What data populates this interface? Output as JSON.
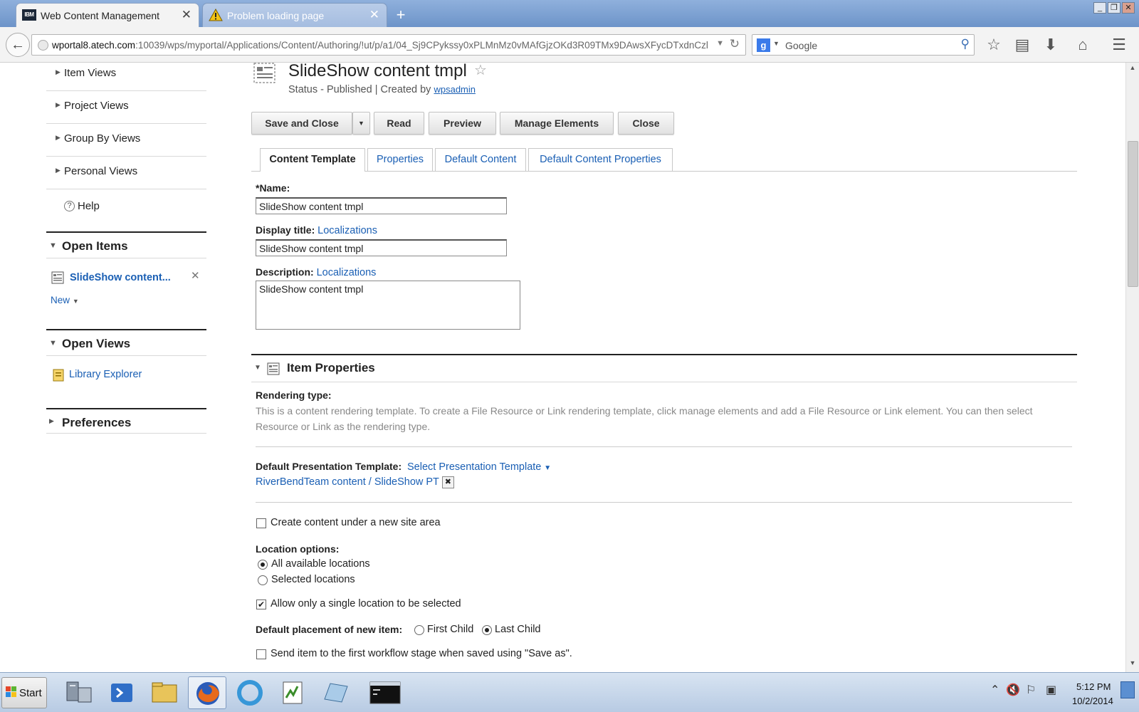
{
  "browser": {
    "tabs": [
      {
        "favicon": "IBM",
        "label": "Web Content Management",
        "close": "✕"
      },
      {
        "label": "Problem loading page",
        "close": "✕"
      }
    ],
    "new_tab": "+",
    "url_host": "wportal8.atech.com",
    "url_rest": ":10039/wps/myportal/Applications/Content/Authoring/!ut/p/a1/04_Sj9CPykssy0xPLMnMz0vMAfGjzOKd3R09TMx9DAwsXFycDTxdnCzl",
    "search_engine": "g",
    "search_placeholder": "Google"
  },
  "sidebar": {
    "views": [
      {
        "label": "Item Views"
      },
      {
        "label": "Project Views"
      },
      {
        "label": "Group By Views"
      },
      {
        "label": "Personal Views"
      }
    ],
    "help_icon": "?",
    "help_label": "Help",
    "open_items_title": "Open Items",
    "open_item_label": "SlideShow content...",
    "new_label": "New",
    "open_views_title": "Open Views",
    "library_explorer": "Library Explorer",
    "preferences_title": "Preferences"
  },
  "header": {
    "title": "SlideShow content tmpl",
    "status_prefix": "Status - Published | Created by",
    "author": "wpsadmin"
  },
  "toolbar": {
    "save_close": "Save and Close",
    "read": "Read",
    "preview": "Preview",
    "manage_elements": "Manage Elements",
    "close": "Close"
  },
  "tabs": [
    {
      "label": "Content Template"
    },
    {
      "label": "Properties"
    },
    {
      "label": "Default Content"
    },
    {
      "label": "Default Content Properties"
    }
  ],
  "form": {
    "name_label": "*Name:",
    "name_value": "SlideShow content tmpl",
    "display_title_label": "Display title:",
    "display_title_link": "Localizations",
    "display_title_value": "SlideShow content tmpl",
    "description_label": "Description:",
    "description_link": "Localizations",
    "description_value": "SlideShow content tmpl"
  },
  "item_properties": {
    "title": "Item Properties",
    "rendering_type_label": "Rendering type:",
    "rendering_type_text": "This is a content rendering template. To create a File Resource or Link rendering template, click manage elements and add a File Resource or Link element. You can then select Resource or Link as the rendering type.",
    "default_pt_label": "Default Presentation Template:",
    "select_pt_link": "Select Presentation Template",
    "pt_value": "RiverBendTeam content / SlideShow PT",
    "create_under_site_area": "Create content under a new site area",
    "location_options_label": "Location options:",
    "all_locations": "All available locations",
    "selected_locations": "Selected locations",
    "single_location": "Allow only a single location to be selected",
    "placement_label": "Default placement of new item:",
    "first_child": "First Child",
    "last_child": "Last Child",
    "send_workflow": "Send item to the first workflow stage when saved using \"Save as\"."
  },
  "taskbar": {
    "start": "Start",
    "time": "5:12 PM",
    "date": "10/2/2014"
  },
  "colors": {
    "link": "#1a5fb4",
    "titlebar": "#7a9fd2",
    "taskbar": "#c6d6ea"
  }
}
